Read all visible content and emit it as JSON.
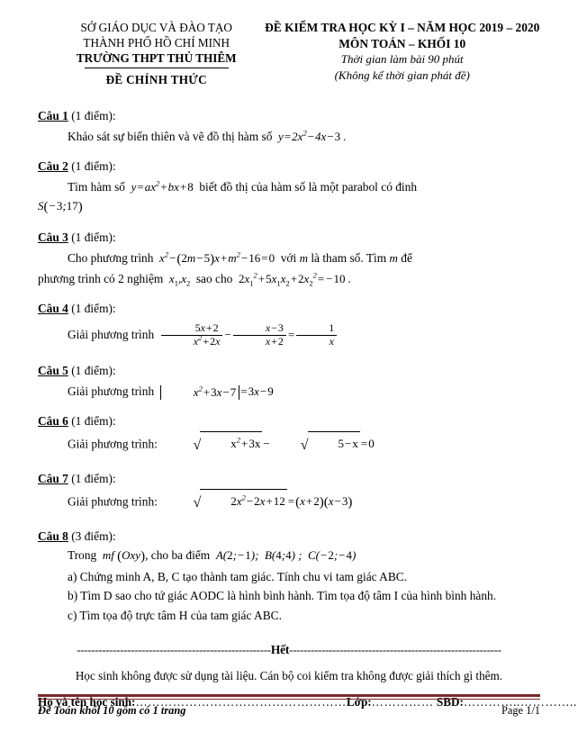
{
  "header": {
    "left": {
      "line1": "SỞ GIÁO DỤC VÀ ĐÀO TẠO",
      "line2": "THÀNH PHỐ HỒ CHÍ MINH",
      "line3": "TRƯỜNG THPT THỦ THIÊM",
      "official": "ĐỀ CHÍNH THỨC"
    },
    "right": {
      "line1": "ĐỀ KIỂM TRA HỌC KỲ I – NĂM HỌC 2019 – 2020",
      "line2": "MÔN TOÁN – KHỐI 10",
      "line3": "Thời gian làm bài 90 phút",
      "line4": "(Không kể thời gian phát đề)"
    }
  },
  "questions": [
    {
      "label": "Câu 1",
      "points": "(1 điểm):",
      "prompt": "Khảo sát sự biến thiên và vẽ đồ thị hàm số"
    },
    {
      "label": "Câu 2",
      "points": "(1 điểm):",
      "prompt_a": "Tìm hàm số",
      "prompt_b": "biết đồ thị của hàm số là một parabol có đinh"
    },
    {
      "label": "Câu 3",
      "points": "(1 điểm):",
      "prompt_a": "Cho phương trình",
      "prompt_b": "với",
      "prompt_c": "là tham số. Tìm",
      "prompt_d": "để",
      "prompt_e": "phương trình có 2 nghiệm",
      "prompt_f": "sao cho"
    },
    {
      "label": "Câu 4",
      "points": "(1 điểm):",
      "prompt": "Giải phương trình"
    },
    {
      "label": "Câu 5",
      "points": "(1 điểm):",
      "prompt": "Giải phương trình"
    },
    {
      "label": "Câu 6",
      "points": "(1 điểm):",
      "prompt": "Giải phương trình:"
    },
    {
      "label": "Câu 7",
      "points": "(1 điểm):",
      "prompt": "Giải phương trình:"
    },
    {
      "label": "Câu 8",
      "points": "(3 điểm):",
      "intro_a": "Trong",
      "intro_b": ", cho ba điểm",
      "part_a": "a) Chứng minh A, B, C tạo thành tam giác. Tính chu vi tam giác ABC.",
      "part_b": "b) Tìm D sao cho tứ giác AODC là hình bình hành. Tìm tọa độ tâm I của hình bình hành.",
      "part_c": "c) Tìm tọa độ trực tâm H của tam giác ABC."
    }
  ],
  "math": {
    "q1_fn": "y = 2x² − 4x − 3 .",
    "q2_fn": "y = ax² + bx + 8",
    "q2_vertex": "S(−3;17)",
    "q3_eq": "x² − (2m − 5)x + m² − 16 = 0",
    "q3_var": "m",
    "q3_roots": "x₁, x₂",
    "q3_cond": "2x₁² + 5x₁x₂ + 2x₂² = −10 .",
    "q4_eq": "(5x + 2)/(x² + 2x) − (x − 3)/(x + 2) = 1/x",
    "q5_eq": "|x² + 3x − 7| = 3x − 9",
    "q6_eq": "√(x² + 3x) − √(5 − x) = 0",
    "q7_eq": "√(2x² − 2x + 12) = (x + 2)(x − 3)",
    "q8_plane": "mf (Oxy)",
    "q8_points": "A(2;−1);  B(4;4) ;  C(−2;−4)"
  },
  "footer_block": {
    "het_dashes_left": "------------------------------------------------------",
    "het_word": "Hết",
    "het_dashes_right": "-----------------------------------------------------------",
    "note": "Học sinh không được sử dụng tài liệu. Cán bộ coi kiểm tra không được giải thích gì thêm.",
    "name_label": "Họ và tên học sinh:",
    "name_dots": "……………………………………………",
    "class_label": "Lớp:",
    "class_dots": "……………",
    "sbd_label": "SBD:",
    "sbd_dots": "…………..………….."
  },
  "page_footer": {
    "left": "Đề Toán khối 10 gồm có 1 trang",
    "right": "Page 1/1",
    "rule_color": "#7a2b2b"
  }
}
